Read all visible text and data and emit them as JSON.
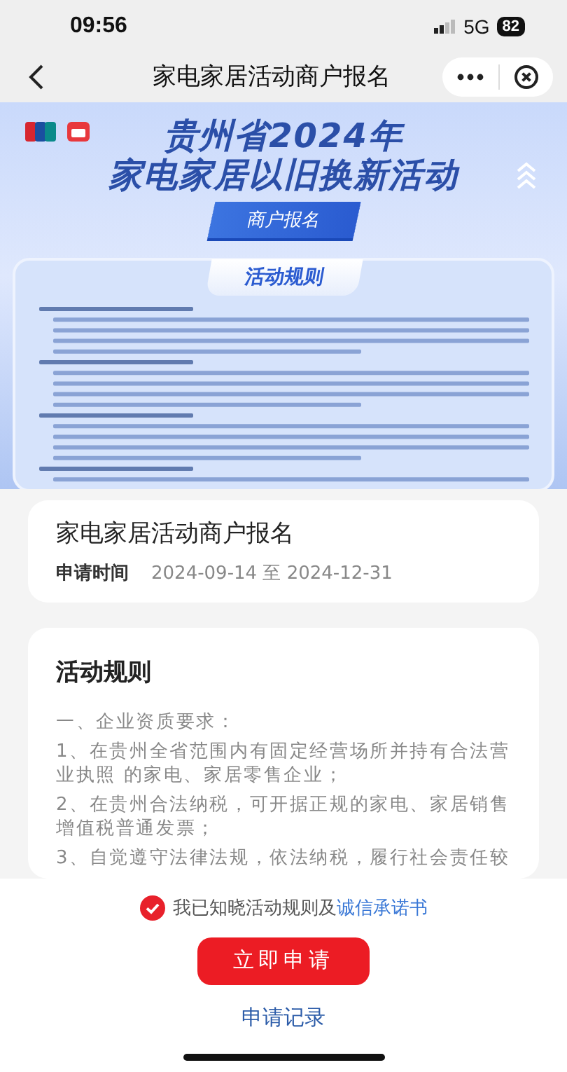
{
  "status_bar": {
    "time": "09:56",
    "network": "5G",
    "battery": "82"
  },
  "nav": {
    "title": "家电家居活动商户报名"
  },
  "banner": {
    "title_line1": "贵州省2024年",
    "title_line2": "家电家居以旧换新活动",
    "badge": "商户报名",
    "rules_tab": "活动规则"
  },
  "activity": {
    "title": "家电家居活动商户报名",
    "date_label": "申请时间",
    "date_range": "2024-09-14 至 2024-12-31"
  },
  "rules": {
    "title": "活动规则",
    "paragraphs": [
      "一、企业资质要求：",
      "1、在贵州全省范围内有固定经营场所并持有合法营业执照 的家电、家居零售企业；",
      "2、在贵州合法纳税，可开据正规的家电、家居销售增值税普通发票；",
      "3、自觉遵守法律法规，依法纳税，履行社会责任较"
    ]
  },
  "agreement": {
    "checked": true,
    "text": "我已知晓活动规则及",
    "link": "诚信承诺书"
  },
  "apply_button": "立即申请",
  "records_link": "申请记录"
}
